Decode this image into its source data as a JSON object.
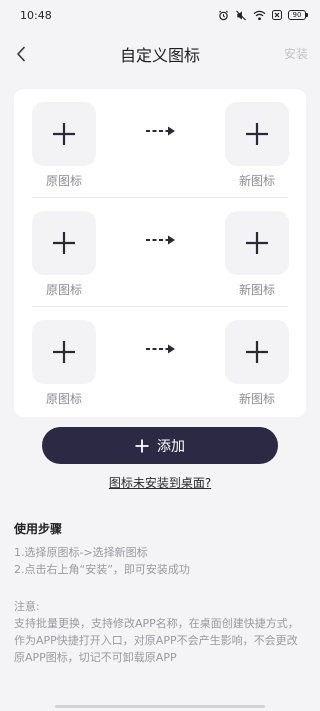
{
  "status_bar": {
    "time": "10:48",
    "battery": "90"
  },
  "nav": {
    "title": "自定义图标",
    "install_label": "安装"
  },
  "pairs": [
    {
      "original_label": "原图标",
      "new_label": "新图标"
    },
    {
      "original_label": "原图标",
      "new_label": "新图标"
    },
    {
      "original_label": "原图标",
      "new_label": "新图标"
    }
  ],
  "add_button": {
    "label": "添加"
  },
  "help_link": "图标未安装到桌面?",
  "steps": {
    "title": "使用步骤",
    "line1": "1.选择原图标->选择新图标",
    "line2": "2.点击右上角“安装”，即可安装成功"
  },
  "note": {
    "title": "注意:",
    "text": "支持批量更换，支持修改APP名称，在桌面创建快捷方式，作为APP快捷打开入口，对原APP不会产生影响，不会更改原APP图标，切记不可卸载原APP"
  },
  "colors": {
    "accent": "#2c2944",
    "background": "#f4f4f6",
    "card": "#ffffff",
    "muted_text": "#9a9aa0"
  }
}
